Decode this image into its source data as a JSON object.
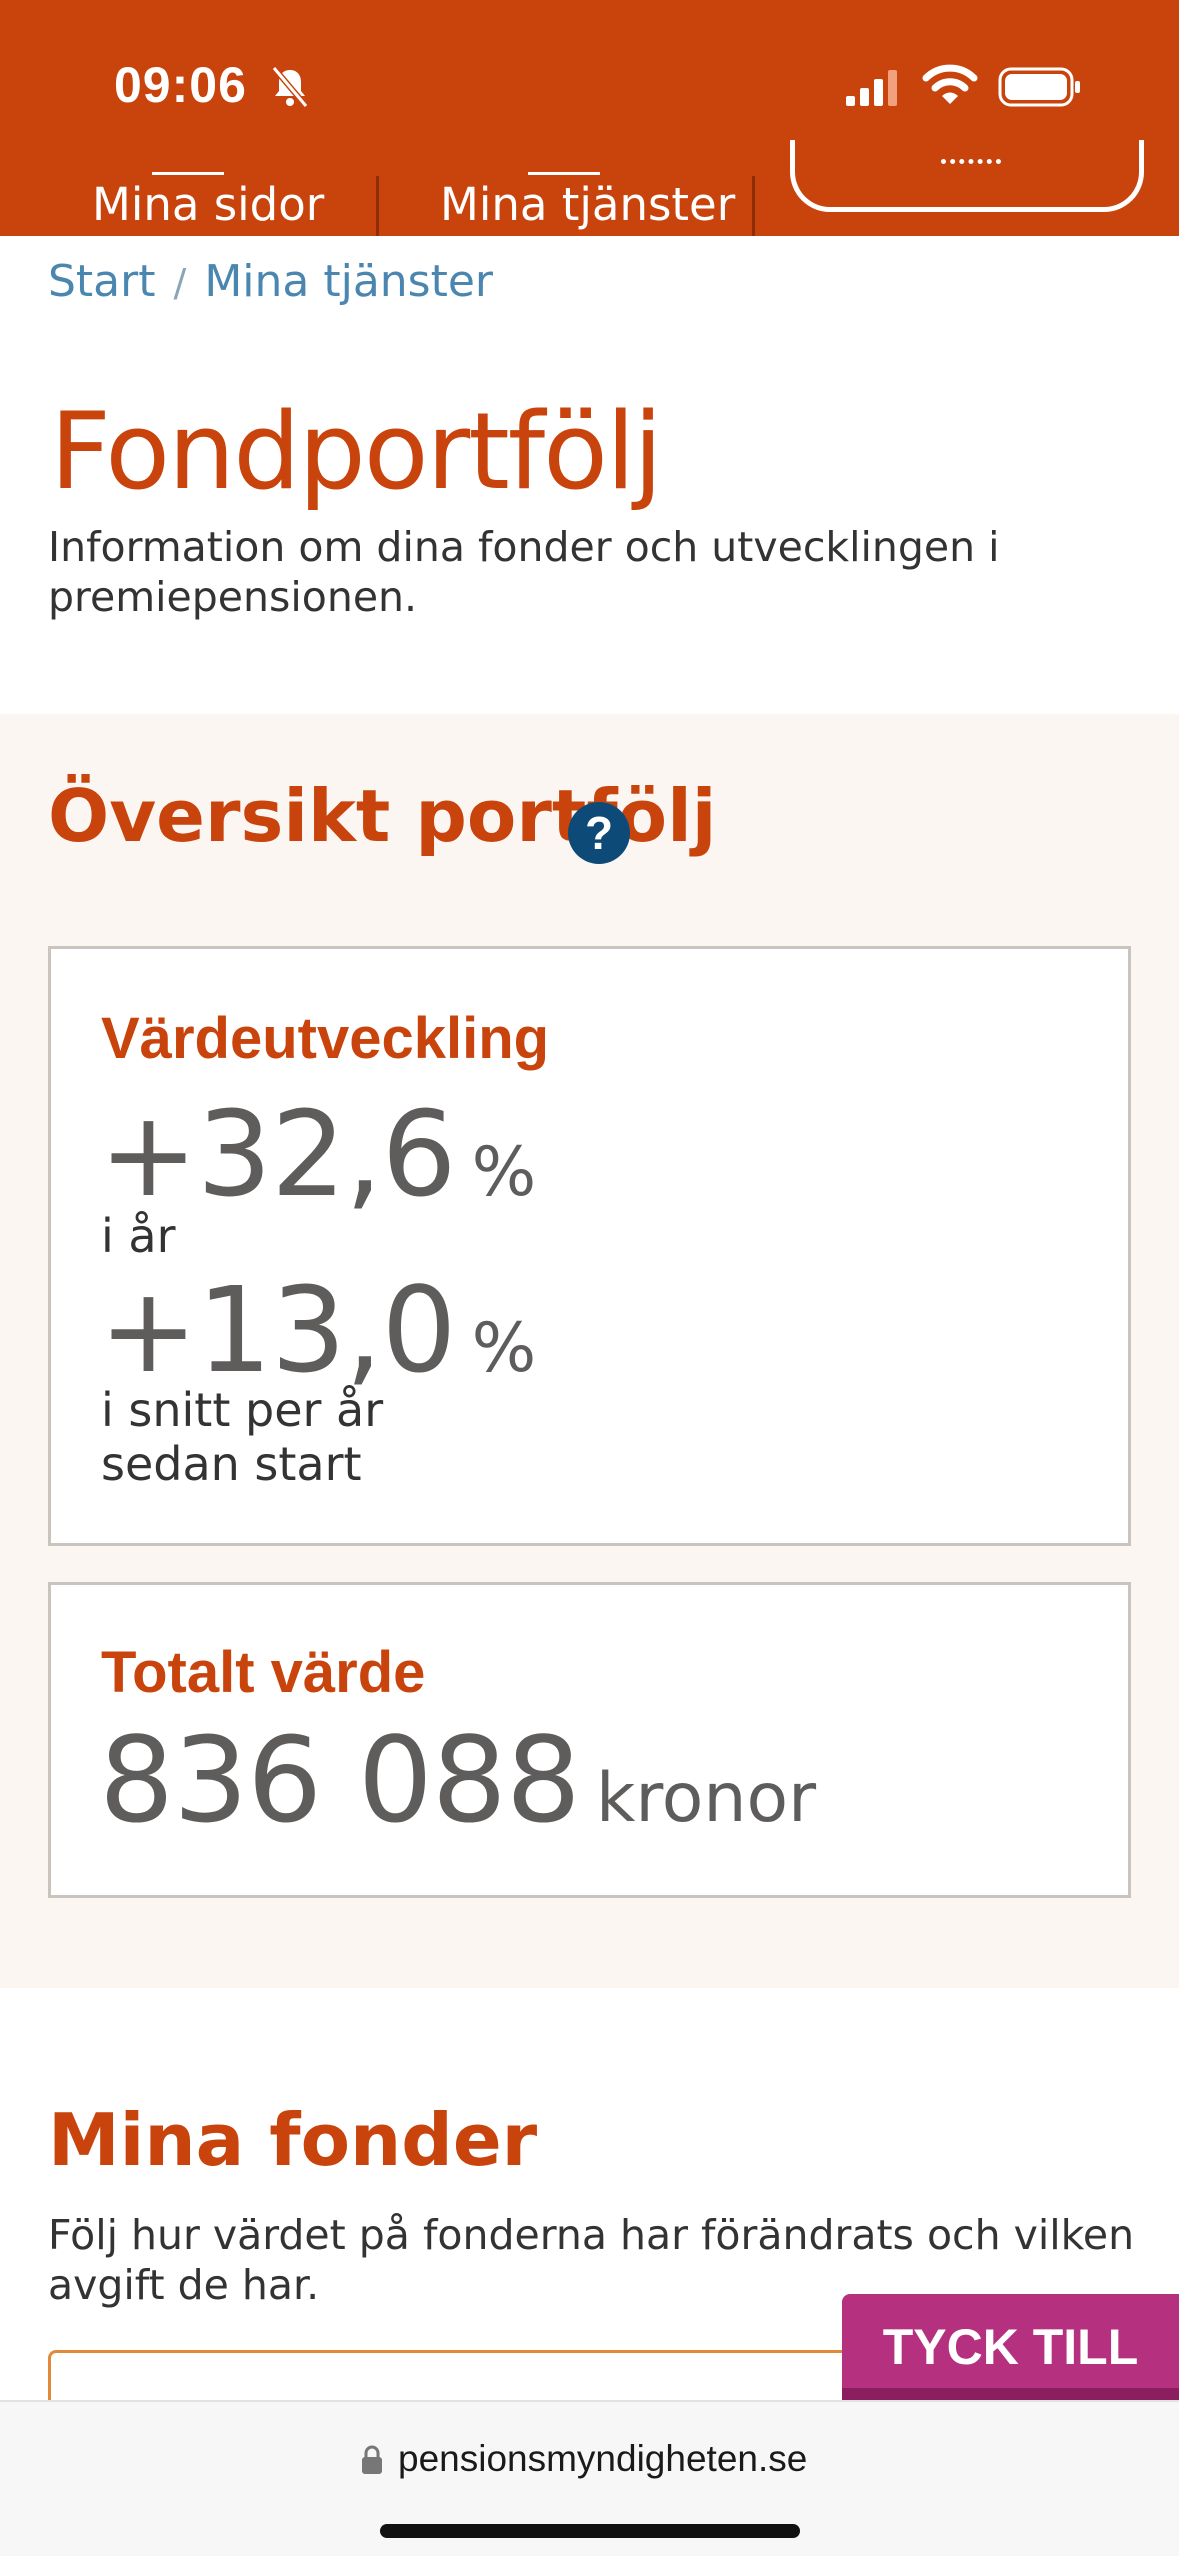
{
  "status_bar": {
    "time": "09:06"
  },
  "nav": {
    "tabs": [
      {
        "label": "Mina sidor"
      },
      {
        "label": "Mina tjänster"
      }
    ]
  },
  "breadcrumb": {
    "items": [
      "Start",
      "Mina tjänster"
    ],
    "separator": "/"
  },
  "page": {
    "title": "Fondportfölj",
    "intro": "Information om dina fonder och utvecklingen i premiepensionen."
  },
  "overview": {
    "title": "Översikt portfölj",
    "help_glyph": "?",
    "development": {
      "heading": "Värdeutveckling",
      "year_value": "+32,6",
      "year_unit": "%",
      "year_caption": "i år",
      "avg_value": "+13,0",
      "avg_unit": "%",
      "avg_caption_line1": "i snitt per år",
      "avg_caption_line2": "sedan start"
    },
    "total": {
      "heading": "Totalt värde",
      "value": "836 088",
      "unit": "kronor"
    }
  },
  "funds": {
    "title": "Mina fonder",
    "intro": "Följ hur värdet på fonderna har förändrats och vilken avgift de har."
  },
  "feedback": {
    "label": "TYCK TILL"
  },
  "browser": {
    "url": "pensionsmyndigheten.se"
  },
  "colors": {
    "brand": "#c8440c",
    "link": "#4a86b0",
    "help": "#0e4a78",
    "feedback": "#b5307f"
  }
}
